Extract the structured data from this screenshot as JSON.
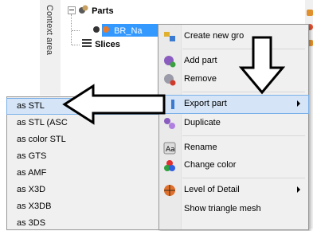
{
  "side_tab": {
    "label": "Context area"
  },
  "tree": {
    "nodes": [
      {
        "label": "Parts"
      },
      {
        "label": "BR_Na"
      },
      {
        "label": "Slices"
      }
    ]
  },
  "context_menu": {
    "items": [
      {
        "label": "Create new gro",
        "icon": "create-group-icon"
      },
      {
        "label": "Add part",
        "icon": "add-part-icon"
      },
      {
        "label": "Remove",
        "icon": "remove-icon"
      },
      {
        "label": "Export part",
        "icon": "export-icon",
        "submenu": true,
        "highlighted": true
      },
      {
        "label": "Duplicate",
        "icon": "duplicate-icon"
      },
      {
        "label": "Rename",
        "icon": "rename-icon"
      },
      {
        "label": "Change color",
        "icon": "change-color-icon"
      },
      {
        "label": "Level of Detail",
        "icon": "lod-icon",
        "submenu": true
      },
      {
        "label": "Show triangle mesh",
        "icon": ""
      }
    ]
  },
  "export_submenu": {
    "items": [
      {
        "label": "as STL",
        "highlighted": true
      },
      {
        "label": "as STL (ASC"
      },
      {
        "label": "as color STL"
      },
      {
        "label": "as GTS"
      },
      {
        "label": "as AMF"
      },
      {
        "label": "as X3D"
      },
      {
        "label": "as X3DB"
      },
      {
        "label": "as 3DS"
      }
    ]
  },
  "colors": {
    "highlight": "#d5e5f7",
    "selection": "#3399ff",
    "menu_bg": "#f0f0f0"
  }
}
